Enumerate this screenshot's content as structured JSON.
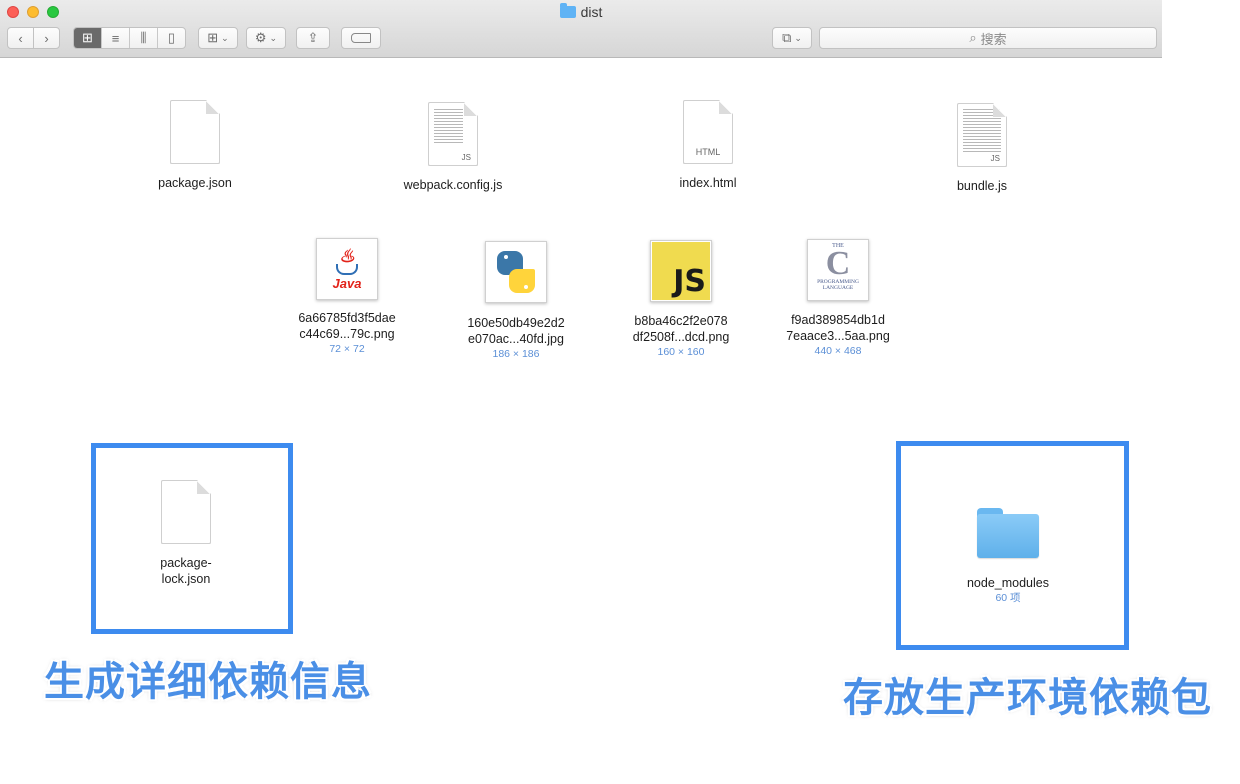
{
  "window": {
    "title": "dist"
  },
  "toolbar": {
    "back_icon": "chevron-left-icon",
    "forward_icon": "chevron-right-icon",
    "view_modes": [
      "icon-view",
      "list-view",
      "column-view",
      "cover-flow-view"
    ],
    "search_placeholder": "搜索"
  },
  "files_row1": [
    {
      "name": "package.json",
      "icon": "json-doc-icon"
    },
    {
      "name": "webpack.config.js",
      "icon": "js-doc-icon",
      "badge": "JS"
    },
    {
      "name": "index.html",
      "icon": "html-doc-icon",
      "badge": "HTML"
    },
    {
      "name": "bundle.js",
      "icon": "js-doc-icon",
      "badge": "JS"
    }
  ],
  "files_row2": [
    {
      "name": "6a66785fd3f5dae\nc44c69...79c.png",
      "meta": "72 × 72",
      "icon": "java-thumb"
    },
    {
      "name": "160e50db49e2d2\ne070ac...40fd.jpg",
      "meta": "186 × 186",
      "icon": "python-thumb"
    },
    {
      "name": "b8ba46c2f2e078\ndf2508f...dcd.png",
      "meta": "160 × 160",
      "icon": "js-thumb",
      "thumb_text": "JS"
    },
    {
      "name": "f9ad389854db1d\n7eaace3...5aa.png",
      "meta": "440 × 468",
      "icon": "c-book-thumb",
      "thumb_top": "THE",
      "thumb_letter": "C",
      "thumb_bottom": "PROGRAMMING\nLANGUAGE"
    }
  ],
  "java_thumb_text": "Java",
  "highlighted": {
    "lockfile": {
      "name": "package-\nlock.json"
    },
    "node_modules": {
      "name": "node_modules",
      "meta": "60 项"
    }
  },
  "annotations": {
    "left": "生成详细依赖信息",
    "right": "存放生产环境依赖包",
    "color": "#3d8bef"
  }
}
